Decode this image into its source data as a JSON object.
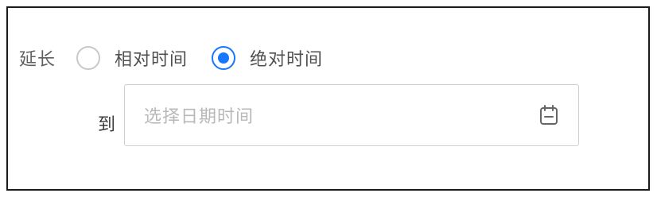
{
  "extend": {
    "label": "延长",
    "options": [
      {
        "label": "相对时间",
        "checked": false
      },
      {
        "label": "绝对时间",
        "checked": true
      }
    ]
  },
  "to": {
    "label": "到",
    "placeholder": "选择日期时间",
    "icon": "calendar-icon"
  },
  "colors": {
    "accent": "#1677ff",
    "border": "#cfcfcf",
    "placeholder": "#b8b8b8"
  }
}
